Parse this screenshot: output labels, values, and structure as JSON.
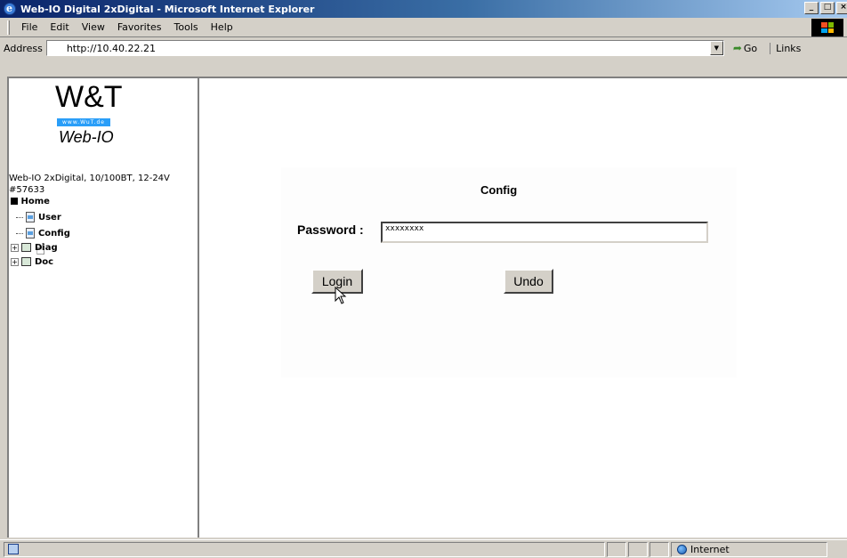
{
  "window": {
    "title": "Web-IO Digital 2xDigital - Microsoft Internet Explorer",
    "controls": [
      "_",
      "□",
      "×"
    ]
  },
  "menu": {
    "items": [
      "File",
      "Edit",
      "View",
      "Favorites",
      "Tools",
      "Help"
    ]
  },
  "address": {
    "label": "Address",
    "url": "http://10.40.22.21",
    "go": "Go",
    "links": "Links"
  },
  "sidebar": {
    "logo_main": "W&T",
    "logo_url": "www.WuT.de",
    "logo_product": "Web-IO",
    "device_info_line1": "Web-IO 2xDigital, 10/100BT, 12-24V",
    "device_info_line2": "#57633",
    "tree": {
      "home": "Home",
      "user": "User",
      "config": "Config",
      "diag": "Diag",
      "doc": "Doc"
    }
  },
  "main": {
    "title": "Config",
    "password_label": "Password :",
    "password_value": "xxxxxxxx",
    "login_label": "Login",
    "undo_label": "Undo"
  },
  "status": {
    "zone": "Internet"
  },
  "colors": {
    "titlebar_start": "#0a246a",
    "titlebar_end": "#a6caf0",
    "chrome": "#d4d0c8",
    "logo_blue": "#2a9ef8"
  }
}
